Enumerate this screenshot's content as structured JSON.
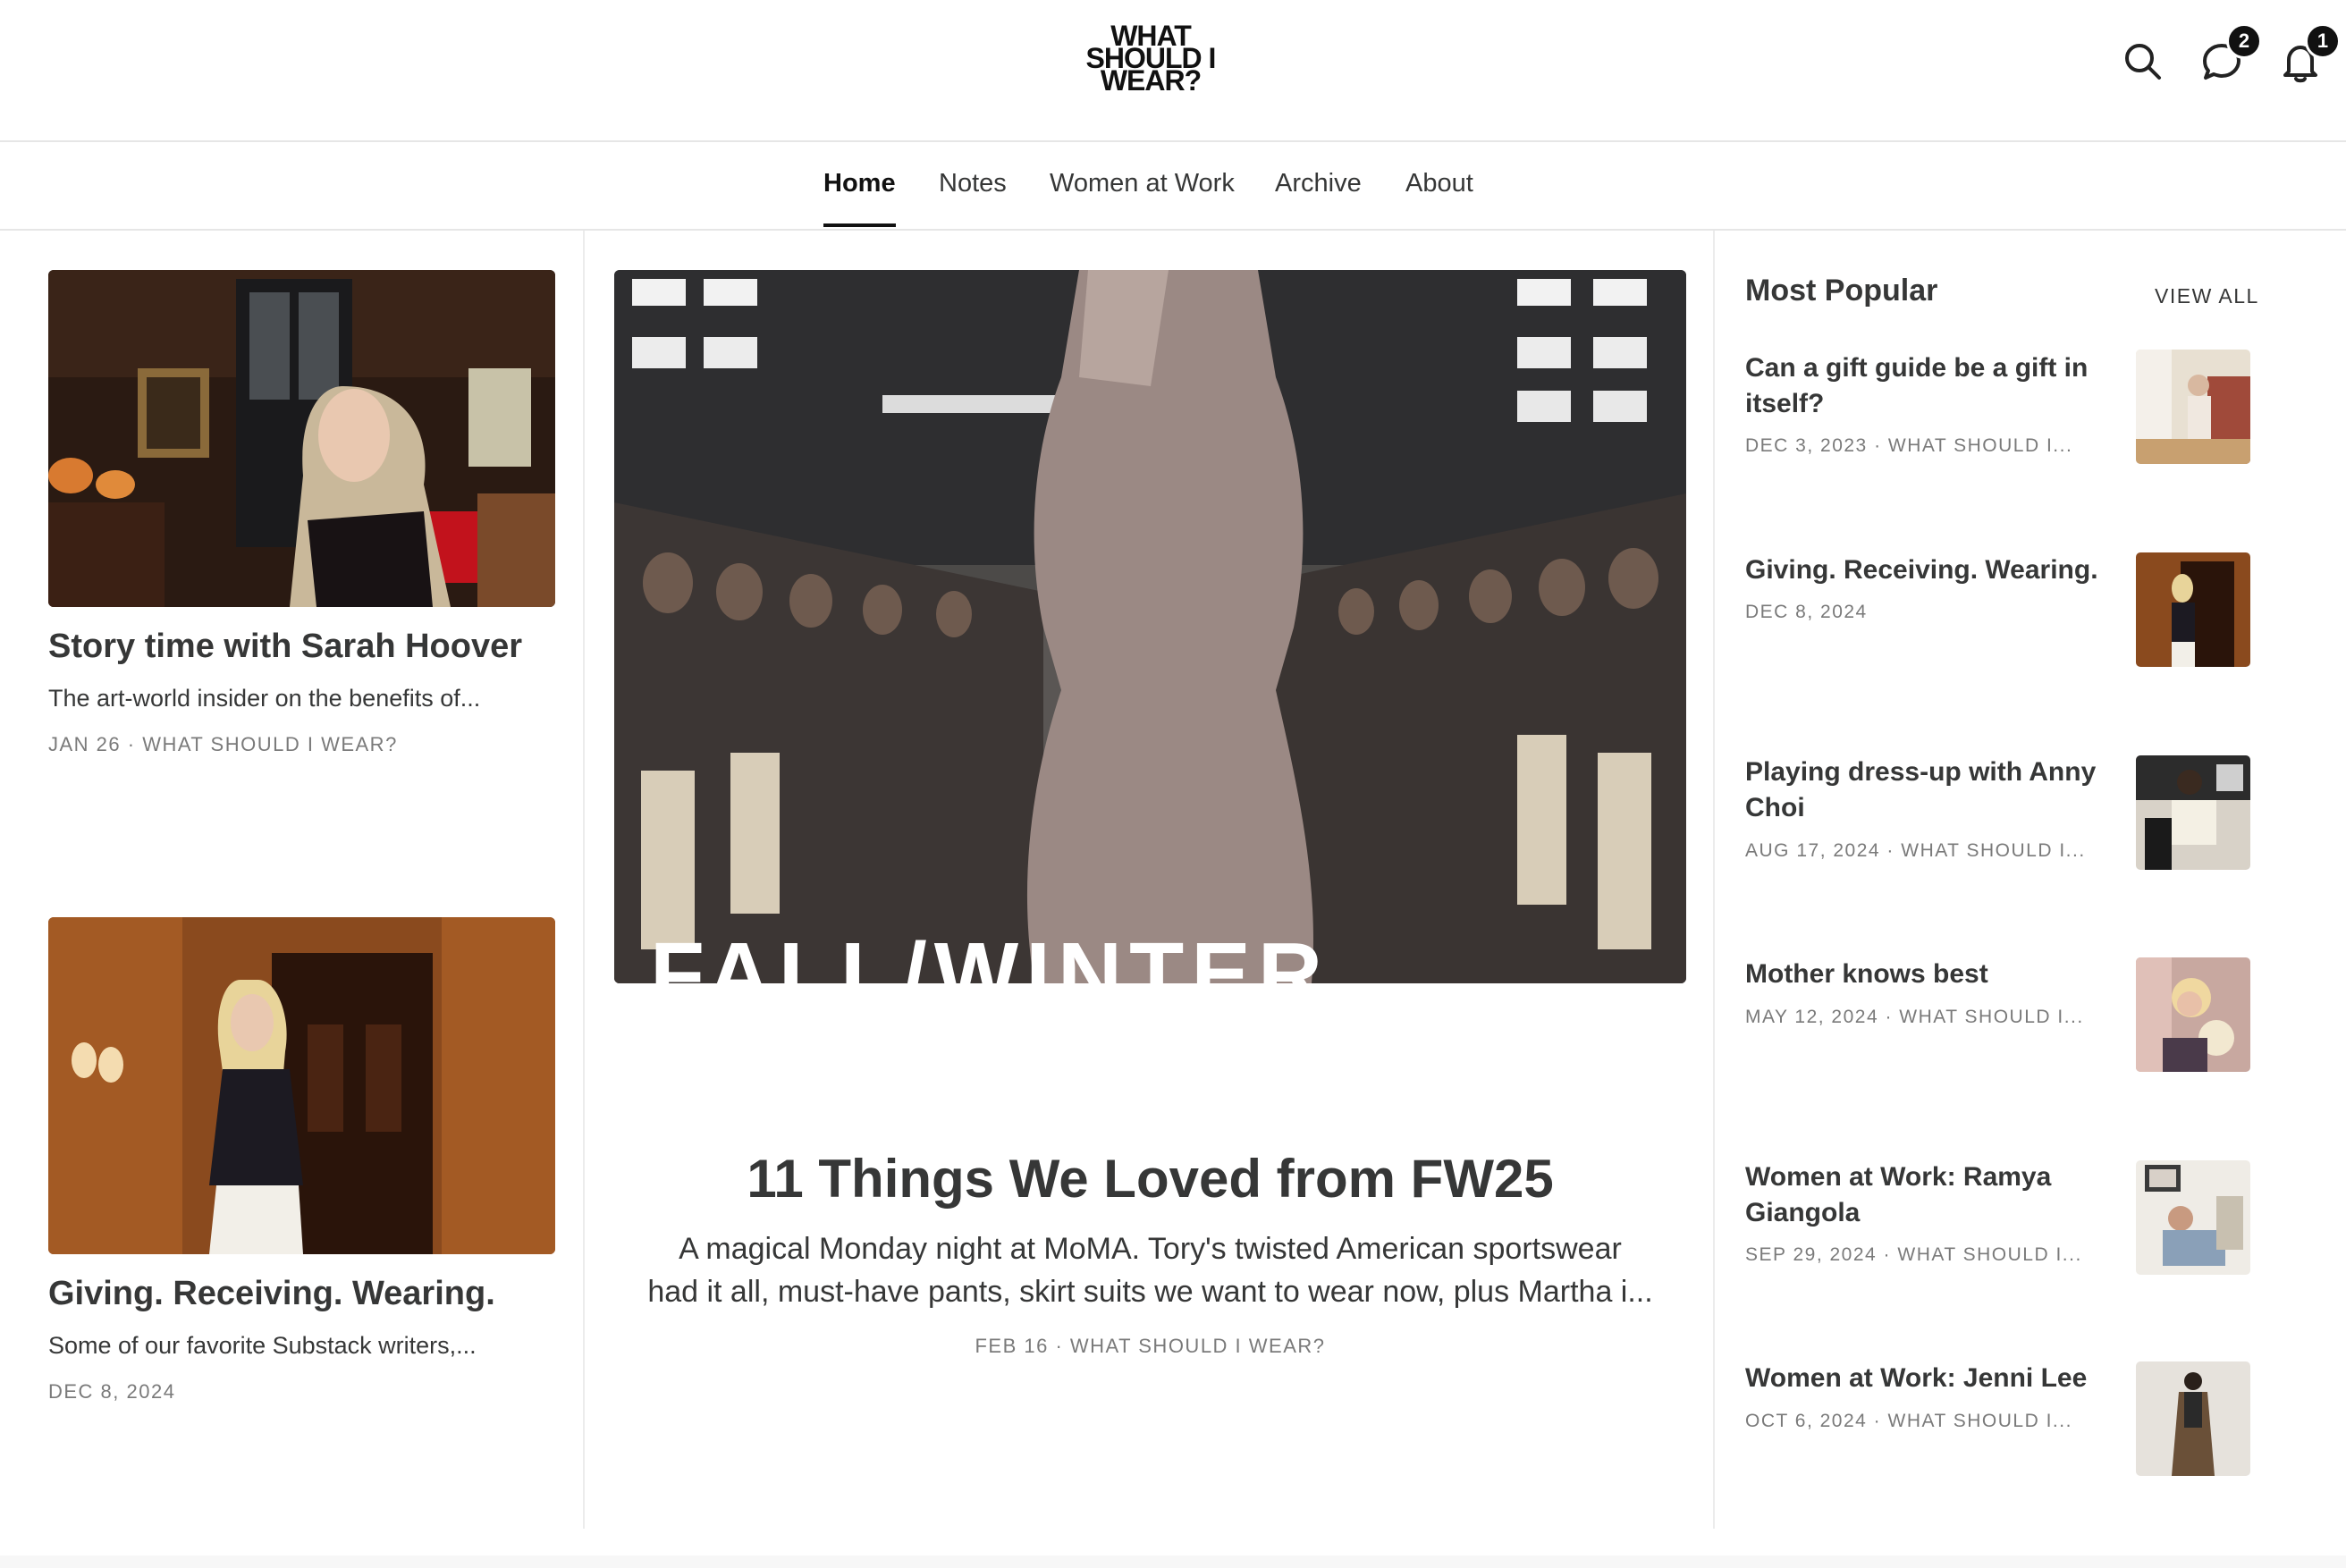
{
  "header": {
    "logo_lines": [
      "WHAT",
      "SHOULD I",
      "WEAR?"
    ],
    "messages_badge": "2",
    "notifications_badge": "1",
    "icons": [
      "search-icon",
      "chat-bubble-icon",
      "bell-icon"
    ]
  },
  "nav": {
    "items": [
      {
        "label": "Home",
        "active": true
      },
      {
        "label": "Notes"
      },
      {
        "label": "Women at Work"
      },
      {
        "label": "Archive"
      },
      {
        "label": "About"
      }
    ]
  },
  "left_posts": [
    {
      "title": "Story time with Sarah Hoover",
      "subtitle": "The art-world insider on the benefits of...",
      "meta": "JAN 26 · WHAT SHOULD I WEAR?"
    },
    {
      "title": "Giving. Receiving. Wearing.",
      "subtitle": "Some of our favorite Substack writers,...",
      "meta": "DEC 8, 2024"
    }
  ],
  "featured": {
    "image_text": "FALL/WINTER",
    "title": "11 Things We Loved from FW25",
    "subtitle_line1": "A magical Monday night at MoMA. Tory's twisted American sportswear",
    "subtitle_line2": "had it all, must-have pants, skirt suits we want to wear now, plus Martha i...",
    "meta": "FEB 16 · WHAT SHOULD I WEAR?"
  },
  "popular": {
    "heading": "Most Popular",
    "view_all": "VIEW ALL",
    "items": [
      {
        "title": "Can a gift guide be a gift in itself?",
        "meta": "DEC 3, 2023 · WHAT SHOULD I..."
      },
      {
        "title": "Giving. Receiving. Wearing.",
        "meta": "DEC 8, 2024"
      },
      {
        "title": "Playing dress-up with Anny Choi",
        "meta": "AUG 17, 2024 · WHAT SHOULD I..."
      },
      {
        "title": "Mother knows best",
        "meta": "MAY 12, 2024 · WHAT SHOULD I..."
      },
      {
        "title": "Women at Work: Ramya Giangola",
        "meta": "SEP 29, 2024 · WHAT SHOULD I..."
      },
      {
        "title": "Women at Work: Jenni Lee",
        "meta": "OCT 6, 2024 · WHAT SHOULD I..."
      }
    ]
  }
}
